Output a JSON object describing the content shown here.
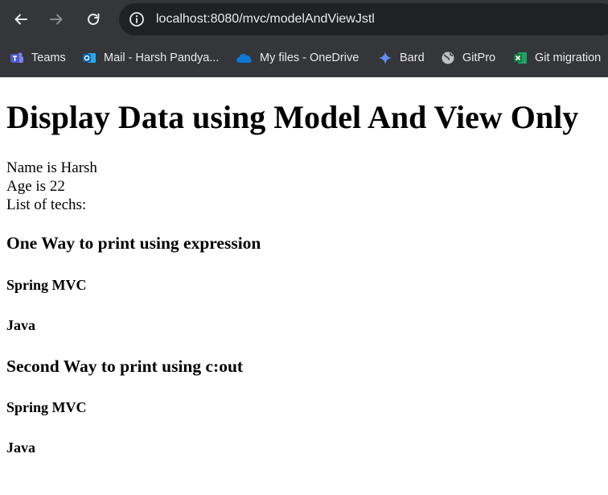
{
  "browser": {
    "url": "localhost:8080/mvc/modelAndViewJstl",
    "bookmarks": [
      {
        "label": "Teams",
        "icon": "teams-icon"
      },
      {
        "label": "Mail - Harsh Pandya...",
        "icon": "outlook-icon"
      },
      {
        "label": "My files - OneDrive",
        "icon": "onedrive-icon"
      },
      {
        "label": "Bard",
        "icon": "bard-icon"
      },
      {
        "label": "GitPro",
        "icon": "globe-icon"
      },
      {
        "label": "Git migration",
        "icon": "excel-icon"
      }
    ]
  },
  "page": {
    "heading": "Display Data using Model And View Only",
    "name_line": "Name is Harsh",
    "age_line": "Age is 22",
    "techs_line": "List of techs:",
    "section1": {
      "title": "One Way to print using expression",
      "items": [
        "Spring MVC",
        "Java"
      ]
    },
    "section2": {
      "title": "Second Way to print using c:out",
      "items": [
        "Spring MVC",
        "Java"
      ]
    }
  }
}
